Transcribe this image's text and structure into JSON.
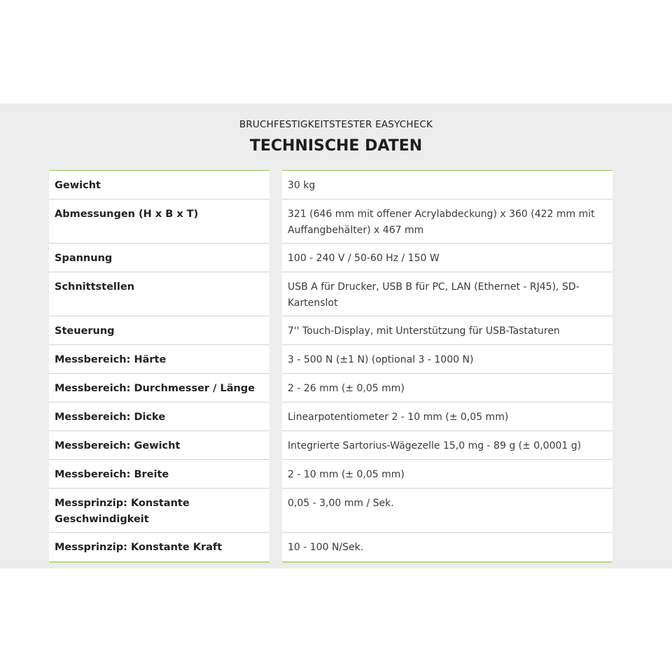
{
  "header": {
    "subtitle": "BRUCHFESTIGKEITSTESTER EASYCHECK",
    "title": "TECHNISCHE DATEN"
  },
  "rows": [
    {
      "label": "Gewicht",
      "value": "30 kg"
    },
    {
      "label": "Abmessungen (H x B x T)",
      "value": "321 (646 mm mit offener Acrylabdeckung) x 360 (422 mm mit Auffangbehälter) x 467 mm"
    },
    {
      "label": "Spannung",
      "value": "100 - 240 V / 50-60 Hz / 150 W"
    },
    {
      "label": "Schnittstellen",
      "value": "USB A für Drucker, USB B für PC, LAN (Ethernet - RJ45), SD-Kartenslot"
    },
    {
      "label": "Steuerung",
      "value": "7'' Touch-Display, mit Unterstützung für USB-Tastaturen"
    },
    {
      "label": "Messbereich: Härte",
      "value": "3 - 500 N (±1 N) (optional 3 - 1000 N)"
    },
    {
      "label": "Messbereich: Durchmesser / Länge",
      "value": "2 - 26 mm (± 0,05 mm)"
    },
    {
      "label": "Messbereich: Dicke",
      "value": "Linearpotentiometer 2 - 10 mm (± 0,05 mm)"
    },
    {
      "label": "Messbereich: Gewicht",
      "value": "Integrierte Sartorius-Wägezelle 15,0 mg - 89 g (± 0,0001 g)"
    },
    {
      "label": "Messbereich: Breite",
      "value": "2 - 10 mm (± 0,05 mm)"
    },
    {
      "label": "Messprinzip: Konstante Geschwindigkeit",
      "value": "0,05 - 3,00 mm / Sek."
    },
    {
      "label": "Messprinzip: Konstante Kraft",
      "value": "10 - 100 N/Sek."
    }
  ]
}
